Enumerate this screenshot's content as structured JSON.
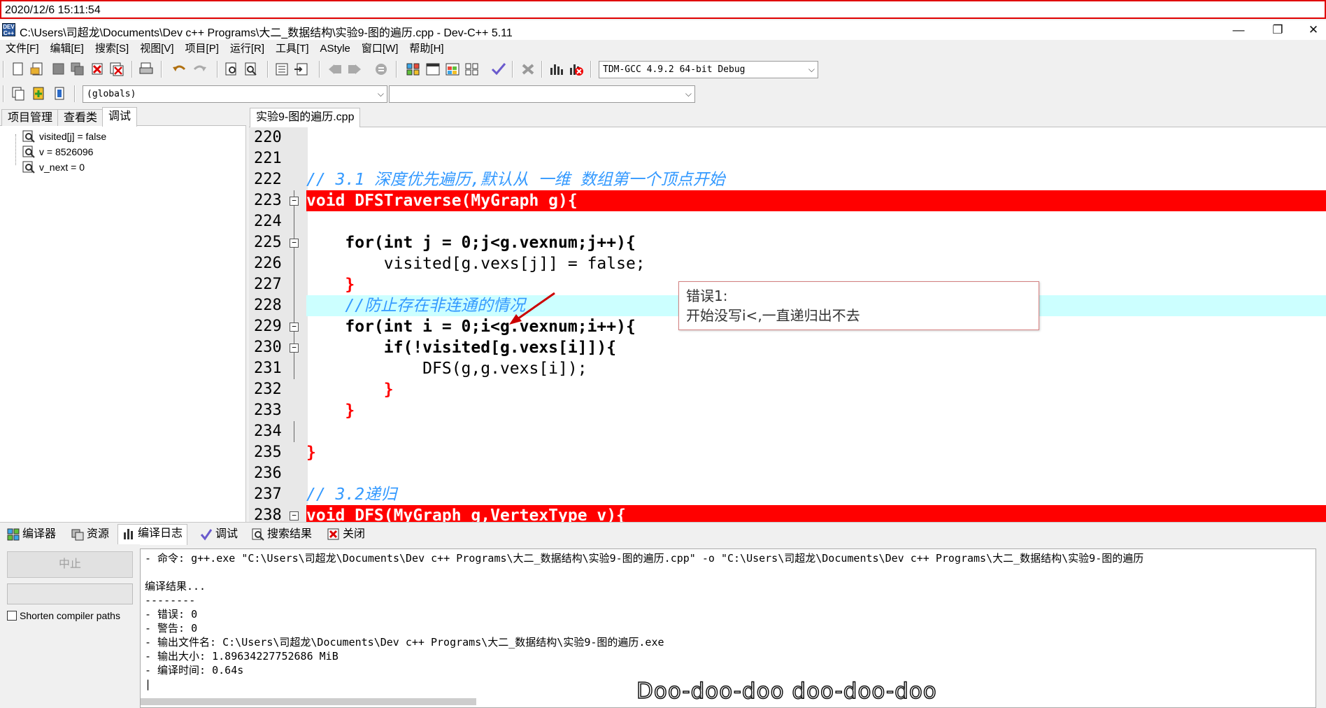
{
  "timestamp": "2020/12/6 15:11:54",
  "window": {
    "title": "C:\\Users\\司超龙\\Documents\\Dev c++ Programs\\大二_数据结构\\实验9-图的遍历.cpp - Dev-C++ 5.11",
    "icon_text": "DEV C++",
    "minimize": "—",
    "restore": "❐",
    "close": "✕"
  },
  "menu": [
    "文件[F]",
    "编辑[E]",
    "搜索[S]",
    "视图[V]",
    "项目[P]",
    "运行[R]",
    "工具[T]",
    "AStyle",
    "窗口[W]",
    "帮助[H]"
  ],
  "toolbar": {
    "compiler_select": "TDM-GCC 4.9.2 64-bit Debug",
    "scope_select": "(globals)",
    "symbol_select": ""
  },
  "left_panel": {
    "tabs": [
      "项目管理",
      "查看类",
      "调试"
    ],
    "active_tab": "调试",
    "watch_items": [
      "visited[j] = false",
      "v = 8526096",
      "v_next = 0"
    ]
  },
  "editor": {
    "file_tab": "实验9-图的遍历.cpp",
    "lines": [
      {
        "num": "220",
        "text": ""
      },
      {
        "num": "221",
        "text": ""
      },
      {
        "num": "222",
        "text": "// 3.1 深度优先遍历,默认从 一维 数组第一个顶点开始"
      },
      {
        "num": "223",
        "text": "void DFSTraverse(MyGraph g){"
      },
      {
        "num": "224",
        "text": ""
      },
      {
        "num": "225",
        "text": "    for(int j = 0;j<g.vexnum;j++){"
      },
      {
        "num": "226",
        "text": "        visited[g.vexs[j]] = false;"
      },
      {
        "num": "227",
        "text": "    }"
      },
      {
        "num": "228",
        "text": "    //防止存在非连通的情况"
      },
      {
        "num": "229",
        "text": "    for(int i = 0;i<g.vexnum;i++){"
      },
      {
        "num": "230",
        "text": "        if(!visited[g.vexs[i]]){"
      },
      {
        "num": "231",
        "text": "            DFS(g,g.vexs[i]);"
      },
      {
        "num": "232",
        "text": "        }"
      },
      {
        "num": "233",
        "text": "    }"
      },
      {
        "num": "234",
        "text": ""
      },
      {
        "num": "235",
        "text": "}"
      },
      {
        "num": "236",
        "text": ""
      },
      {
        "num": "237",
        "text": "// 3.2递归"
      },
      {
        "num": "238",
        "text": "void DFS(MyGraph g,VertexType v){"
      }
    ]
  },
  "annotation": {
    "line1": "错误1:",
    "line2": "开始没写i<,一直递归出不去"
  },
  "bottom_tabs": [
    "编译器",
    "资源",
    "编译日志",
    "调试",
    "搜索结果",
    "关闭"
  ],
  "bottom_active_tab": "编译日志",
  "compile_panel": {
    "stop_button": "中止",
    "shorten_paths": "Shorten compiler paths",
    "log": [
      "- 命令: g++.exe \"C:\\Users\\司超龙\\Documents\\Dev c++ Programs\\大二_数据结构\\实验9-图的遍历.cpp\" -o \"C:\\Users\\司超龙\\Documents\\Dev c++ Programs\\大二_数据结构\\实验9-图的遍历",
      "",
      "编译结果...",
      "--------",
      "- 错误: 0",
      "- 警告: 0",
      "- 输出文件名: C:\\Users\\司超龙\\Documents\\Dev c++ Programs\\大二_数据结构\\实验9-图的遍历.exe",
      "- 输出大小: 1.89634227752686 MiB",
      "- 编译时间: 0.64s"
    ]
  },
  "subtitle": "Doo-doo-doo doo-doo-doo",
  "colors": {
    "breakpoint": "#ff0000",
    "current_line": "#ccffff",
    "comment": "#3399ff",
    "symbol": "#ff0000",
    "number": "#aa00aa"
  }
}
